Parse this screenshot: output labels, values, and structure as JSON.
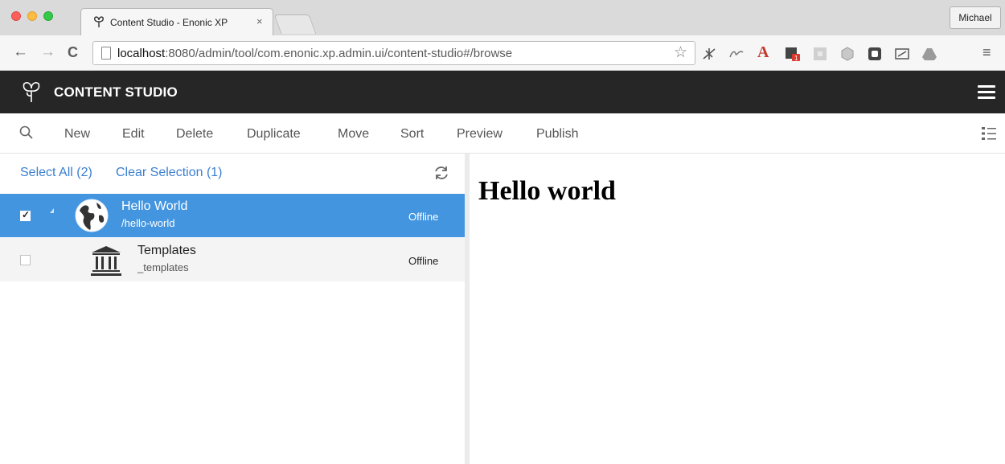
{
  "browser": {
    "tab_title": "Content Studio - Enonic XP",
    "tab_close": "×",
    "user": "Michael",
    "url_host": "localhost",
    "url_path": ":8080/admin/tool/com.enonic.xp.admin.ui/content-studio#/browse",
    "nav": {
      "back": "←",
      "forward": "→",
      "reload": "C"
    },
    "extension_icons": [
      "bookmark-star-icon",
      "bug-icon",
      "signature-icon",
      "acrobat-icon",
      "notification-badge-icon",
      "gray-square-icon",
      "cube-icon",
      "photo-icon",
      "cast-icon",
      "drive-icon",
      "chrome-menu-icon"
    ]
  },
  "app": {
    "title": "CONTENT STUDIO",
    "colors": {
      "header": "#262626",
      "selected_row": "#4395e0",
      "link": "#3a7fcf"
    }
  },
  "toolbar": {
    "items": [
      "New",
      "Edit",
      "Delete",
      "Duplicate",
      "Move",
      "Sort",
      "Preview",
      "Publish"
    ]
  },
  "selection": {
    "select_all": "Select All (2)",
    "clear_selection": "Clear Selection (1)"
  },
  "grid": {
    "rows": [
      {
        "title": "Hello World",
        "path": "/hello-world",
        "status": "Offline",
        "selected": true,
        "icon": "globe-icon"
      },
      {
        "title": "Templates",
        "path": "_templates",
        "status": "Offline",
        "selected": false,
        "icon": "building-icon"
      }
    ]
  },
  "preview": {
    "heading": "Hello world"
  }
}
